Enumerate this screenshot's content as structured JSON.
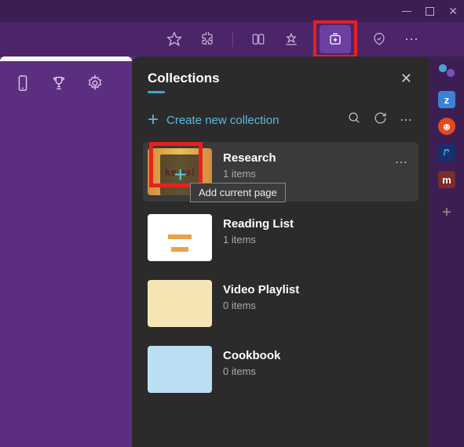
{
  "window": {
    "minimize": "minimize",
    "maximize": "maximize",
    "close": "close"
  },
  "toolbar": {
    "favorite": "favorite",
    "extensions": "extensions",
    "read_aloud": "read-aloud",
    "favorites_list": "favorites-list",
    "collections": "collections",
    "performance": "performance",
    "more": "⋯"
  },
  "left_bar": {
    "mobile": "mobile",
    "rewards": "rewards",
    "settings": "settings"
  },
  "right_sidebar": {
    "copilot": "copilot",
    "apps": [
      {
        "label": "z",
        "color": "#3b82d6"
      },
      {
        "label": "r",
        "color": "#e24a1e",
        "name": "reddit"
      },
      {
        "label": "P",
        "color": "#1a4c8a",
        "name": "paypal"
      },
      {
        "label": "m",
        "color": "#7b2d2a",
        "name": "app-m"
      }
    ],
    "add": "+"
  },
  "panel": {
    "title": "Collections",
    "create_label": "Create new collection",
    "close": "×",
    "tooltip": "Add current page",
    "collections": [
      {
        "title": "Research",
        "count": "1 items",
        "thumb_text": "ke asi",
        "hovered": true
      },
      {
        "title": "Reading List",
        "count": "1 items"
      },
      {
        "title": "Video Playlist",
        "count": "0 items"
      },
      {
        "title": "Cookbook",
        "count": "0 items"
      }
    ]
  }
}
